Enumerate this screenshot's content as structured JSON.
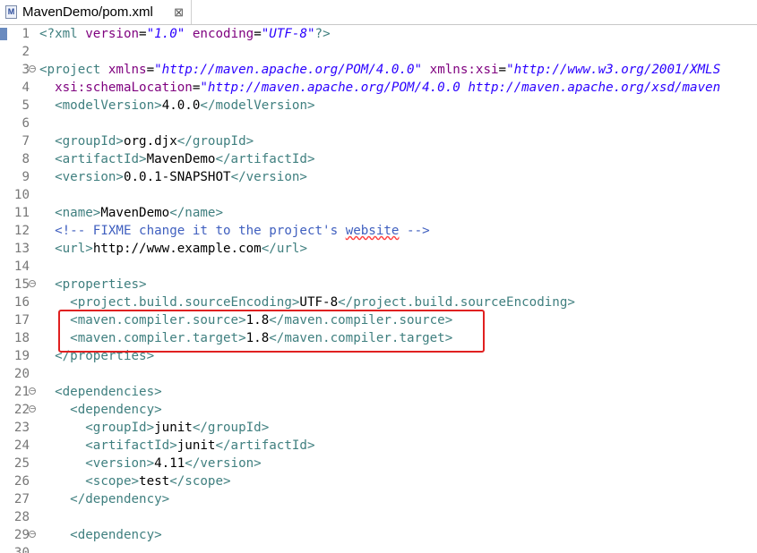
{
  "tab": {
    "title": "MavenDemo/pom.xml",
    "close": "⊠",
    "icon_letter": "M"
  },
  "lines": [
    {
      "n": "1",
      "fold": false,
      "tokens": [
        [
          "pi",
          "<?xml "
        ],
        [
          "a",
          "version"
        ],
        [
          "",
          "="
        ],
        [
          "v",
          "\"1.0\""
        ],
        [
          "",
          " "
        ],
        [
          "a",
          "encoding"
        ],
        [
          "",
          "="
        ],
        [
          "v",
          "\"UTF-8\""
        ],
        [
          "pi",
          "?>"
        ]
      ]
    },
    {
      "n": "2",
      "fold": false,
      "tokens": []
    },
    {
      "n": "3",
      "fold": true,
      "tokens": [
        [
          "t",
          "<project "
        ],
        [
          "a",
          "xmlns"
        ],
        [
          "",
          "="
        ],
        [
          "v",
          "\"http://maven.apache.org/POM/4.0.0\""
        ],
        [
          "",
          " "
        ],
        [
          "a",
          "xmlns:xsi"
        ],
        [
          "",
          "="
        ],
        [
          "v",
          "\"http://www.w3.org/2001/XMLS"
        ]
      ]
    },
    {
      "n": "4",
      "fold": false,
      "tokens": [
        [
          "",
          "  "
        ],
        [
          "a",
          "xsi:schemaLocation"
        ],
        [
          "",
          "="
        ],
        [
          "v",
          "\"http://maven.apache.org/POM/4.0.0 http://maven.apache.org/xsd/maven"
        ]
      ]
    },
    {
      "n": "5",
      "fold": false,
      "tokens": [
        [
          "",
          "  "
        ],
        [
          "t",
          "<modelVersion>"
        ],
        [
          "",
          "4.0.0"
        ],
        [
          "t",
          "</modelVersion>"
        ]
      ]
    },
    {
      "n": "6",
      "fold": false,
      "tokens": []
    },
    {
      "n": "7",
      "fold": false,
      "tokens": [
        [
          "",
          "  "
        ],
        [
          "t",
          "<groupId>"
        ],
        [
          "",
          "org.djx"
        ],
        [
          "t",
          "</groupId>"
        ]
      ]
    },
    {
      "n": "8",
      "fold": false,
      "tokens": [
        [
          "",
          "  "
        ],
        [
          "t",
          "<artifactId>"
        ],
        [
          "",
          "MavenDemo"
        ],
        [
          "t",
          "</artifactId>"
        ]
      ]
    },
    {
      "n": "9",
      "fold": false,
      "tokens": [
        [
          "",
          "  "
        ],
        [
          "t",
          "<version>"
        ],
        [
          "",
          "0.0.1-SNAPSHOT"
        ],
        [
          "t",
          "</version>"
        ]
      ]
    },
    {
      "n": "10",
      "fold": false,
      "tokens": []
    },
    {
      "n": "11",
      "fold": false,
      "tokens": [
        [
          "",
          "  "
        ],
        [
          "t",
          "<name>"
        ],
        [
          "",
          "MavenDemo"
        ],
        [
          "t",
          "</name>"
        ]
      ]
    },
    {
      "n": "12",
      "fold": false,
      "tokens": [
        [
          "",
          "  "
        ],
        [
          "c",
          "<!-- FIXME change it to the project's "
        ],
        [
          "cs",
          "website"
        ],
        [
          "c",
          " -->"
        ]
      ]
    },
    {
      "n": "13",
      "fold": false,
      "tokens": [
        [
          "",
          "  "
        ],
        [
          "t",
          "<url>"
        ],
        [
          "",
          "http://www.example.com"
        ],
        [
          "t",
          "</url>"
        ]
      ]
    },
    {
      "n": "14",
      "fold": false,
      "tokens": []
    },
    {
      "n": "15",
      "fold": true,
      "tokens": [
        [
          "",
          "  "
        ],
        [
          "t",
          "<properties>"
        ]
      ]
    },
    {
      "n": "16",
      "fold": false,
      "tokens": [
        [
          "",
          "    "
        ],
        [
          "t",
          "<project.build.sourceEncoding>"
        ],
        [
          "",
          "UTF-8"
        ],
        [
          "t",
          "</project.build.sourceEncoding>"
        ]
      ]
    },
    {
      "n": "17",
      "fold": false,
      "tokens": [
        [
          "",
          "    "
        ],
        [
          "t",
          "<maven.compiler.source>"
        ],
        [
          "",
          "1.8"
        ],
        [
          "t",
          "</maven.compiler.source>"
        ]
      ]
    },
    {
      "n": "18",
      "fold": false,
      "tokens": [
        [
          "",
          "    "
        ],
        [
          "t",
          "<maven.compiler.target>"
        ],
        [
          "",
          "1.8"
        ],
        [
          "t",
          "</maven.compiler.target>"
        ]
      ]
    },
    {
      "n": "19",
      "fold": false,
      "tokens": [
        [
          "",
          "  "
        ],
        [
          "t",
          "</properties>"
        ]
      ]
    },
    {
      "n": "20",
      "fold": false,
      "tokens": []
    },
    {
      "n": "21",
      "fold": true,
      "tokens": [
        [
          "",
          "  "
        ],
        [
          "t",
          "<dependencies>"
        ]
      ]
    },
    {
      "n": "22",
      "fold": true,
      "tokens": [
        [
          "",
          "    "
        ],
        [
          "t",
          "<dependency>"
        ]
      ]
    },
    {
      "n": "23",
      "fold": false,
      "tokens": [
        [
          "",
          "      "
        ],
        [
          "t",
          "<groupId>"
        ],
        [
          "",
          "junit"
        ],
        [
          "t",
          "</groupId>"
        ]
      ]
    },
    {
      "n": "24",
      "fold": false,
      "tokens": [
        [
          "",
          "      "
        ],
        [
          "t",
          "<artifactId>"
        ],
        [
          "",
          "junit"
        ],
        [
          "t",
          "</artifactId>"
        ]
      ]
    },
    {
      "n": "25",
      "fold": false,
      "tokens": [
        [
          "",
          "      "
        ],
        [
          "t",
          "<version>"
        ],
        [
          "",
          "4.11"
        ],
        [
          "t",
          "</version>"
        ]
      ]
    },
    {
      "n": "26",
      "fold": false,
      "tokens": [
        [
          "",
          "      "
        ],
        [
          "t",
          "<scope>"
        ],
        [
          "",
          "test"
        ],
        [
          "t",
          "</scope>"
        ]
      ]
    },
    {
      "n": "27",
      "fold": false,
      "tokens": [
        [
          "",
          "    "
        ],
        [
          "t",
          "</dependency>"
        ]
      ]
    },
    {
      "n": "28",
      "fold": false,
      "tokens": []
    },
    {
      "n": "29",
      "fold": true,
      "tokens": [
        [
          "",
          "    "
        ],
        [
          "t",
          "<dependency>"
        ]
      ]
    },
    {
      "n": "30",
      "fold": false,
      "tokens": []
    }
  ],
  "colors": {
    "tag": "#3f7f7f",
    "attr": "#7f007f",
    "value": "#2a00ff",
    "comment": "#3f5fbf",
    "highlight_box": "#e02020"
  }
}
